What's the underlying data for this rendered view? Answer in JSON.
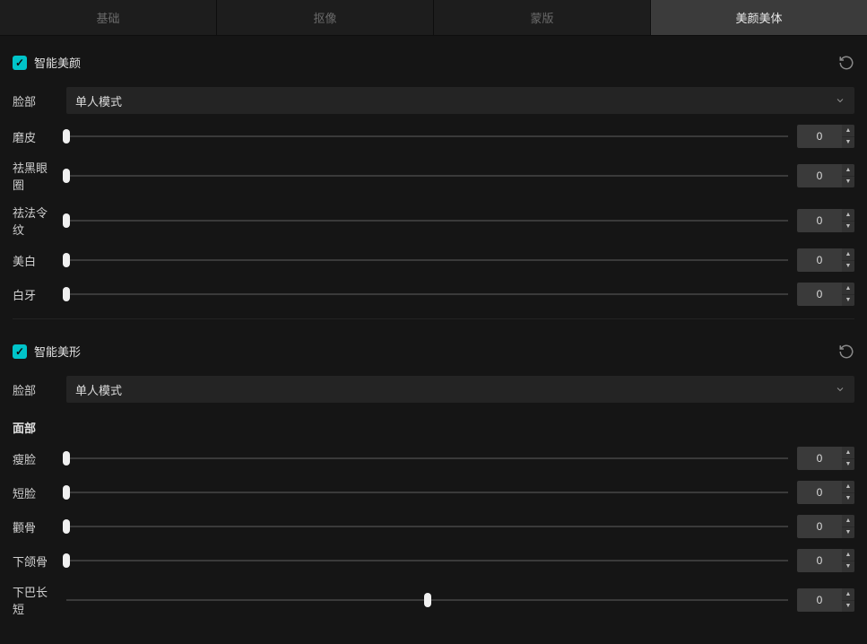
{
  "tabs": [
    {
      "label": "基础",
      "active": false
    },
    {
      "label": "抠像",
      "active": false
    },
    {
      "label": "蒙版",
      "active": false
    },
    {
      "label": "美颜美体",
      "active": true
    }
  ],
  "sections": {
    "beauty": {
      "title": "智能美颜",
      "checked": true,
      "face_label": "脸部",
      "mode_value": "单人模式",
      "sliders": [
        {
          "label": "磨皮",
          "value": 0,
          "pos": 0
        },
        {
          "label": "祛黑眼圈",
          "value": 0,
          "pos": 0
        },
        {
          "label": "祛法令纹",
          "value": 0,
          "pos": 0
        },
        {
          "label": "美白",
          "value": 0,
          "pos": 0
        },
        {
          "label": "白牙",
          "value": 0,
          "pos": 0
        }
      ]
    },
    "shape": {
      "title": "智能美形",
      "checked": true,
      "face_label": "脸部",
      "mode_value": "单人模式",
      "subheader": "面部",
      "sliders": [
        {
          "label": "瘦脸",
          "value": 0,
          "pos": 0
        },
        {
          "label": "短脸",
          "value": 0,
          "pos": 0
        },
        {
          "label": "颧骨",
          "value": 0,
          "pos": 0
        },
        {
          "label": "下颌骨",
          "value": 0,
          "pos": 0
        },
        {
          "label": "下巴长短",
          "value": 0,
          "pos": 50
        }
      ]
    }
  }
}
